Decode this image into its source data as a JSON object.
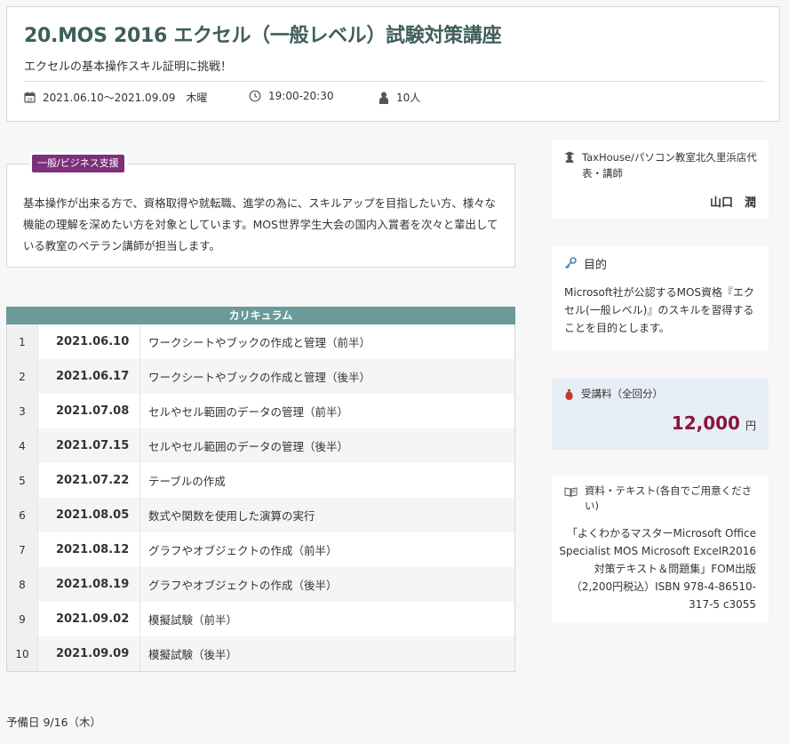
{
  "course": {
    "title": "20.MOS 2016 エクセル（一般レベル）試験対策講座",
    "subtitle": "エクセルの基本操作スキル証明に挑戦！",
    "dates": "2021.06.10〜2021.09.09",
    "weekday": "木曜",
    "time": "19:00-20:30",
    "capacity": "10人"
  },
  "description": {
    "tag": "一般/ビジネス支援",
    "text": "基本操作が出来る方で、資格取得や就転職、進学の為に、スキルアップを目指したい方、様々な機能の理解を深めたい方を対象としています。MOS世界学生大会の国内入賞者を次々と輩出している教室のベテラン講師が担当します。"
  },
  "curriculum": {
    "heading": "カリキュラム",
    "rows": [
      {
        "no": "1",
        "date": "2021.06.10",
        "topic": "ワークシートやブックの作成と管理（前半）"
      },
      {
        "no": "2",
        "date": "2021.06.17",
        "topic": "ワークシートやブックの作成と管理（後半）"
      },
      {
        "no": "3",
        "date": "2021.07.08",
        "topic": "セルやセル範囲のデータの管理（前半）"
      },
      {
        "no": "4",
        "date": "2021.07.15",
        "topic": "セルやセル範囲のデータの管理（後半）"
      },
      {
        "no": "5",
        "date": "2021.07.22",
        "topic": "テーブルの作成"
      },
      {
        "no": "6",
        "date": "2021.08.05",
        "topic": "数式や関数を使用した演算の実行"
      },
      {
        "no": "7",
        "date": "2021.08.12",
        "topic": "グラフやオブジェクトの作成（前半）"
      },
      {
        "no": "8",
        "date": "2021.08.19",
        "topic": "グラフやオブジェクトの作成（後半）"
      },
      {
        "no": "9",
        "date": "2021.09.02",
        "topic": "模擬試験（前半）"
      },
      {
        "no": "10",
        "date": "2021.09.09",
        "topic": "模擬試験（後半）"
      }
    ]
  },
  "reserve_day": "予備日 9/16（木）",
  "instructor": {
    "affiliation": "TaxHouse/パソコン教室北久里浜店代表・講師",
    "name": "山口　潤"
  },
  "purpose": {
    "label": "目的",
    "text": "Microsoft社が公認するMOS資格『エクセル(一般レベル)』のスキルを習得することを目的とします。"
  },
  "fee": {
    "label": "受講料（全回分）",
    "amount": "12,000",
    "unit": "円",
    "color": "#8b1538"
  },
  "materials": {
    "label": "資料・テキスト(各自でご用意ください)",
    "text": "「よくわかるマスターMicrosoft Office Specialist MOS Microsoft ExcelR2016 対策テキスト＆問題集」FOM出版（2,200円税込）ISBN 978-4-86510-317-5 c3055"
  },
  "icons": {
    "calendar": "calendar-icon",
    "clock": "clock-icon",
    "person": "person-icon",
    "teacher": "teacher-icon",
    "key": "key-icon",
    "moneybag": "money-bag-icon",
    "book": "book-icon"
  }
}
